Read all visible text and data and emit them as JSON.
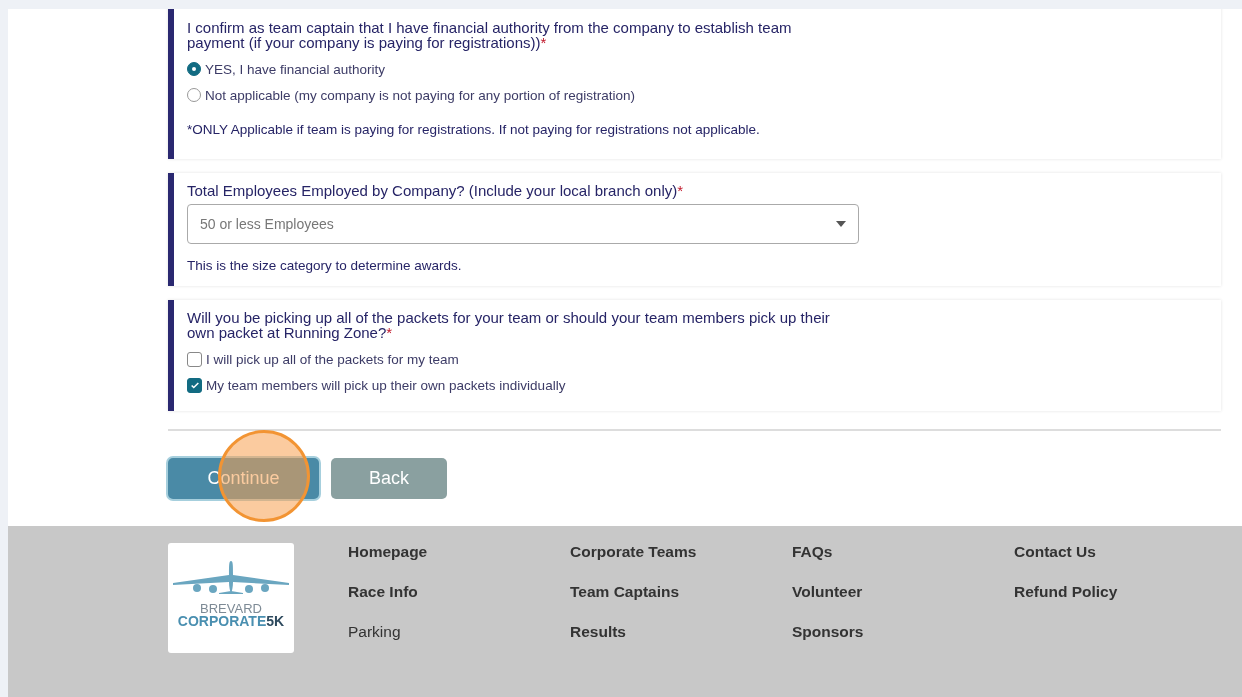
{
  "questions": [
    {
      "kind": "radio",
      "prompt": "I confirm as team captain that I have financial authority from the company to establish team payment (if your company is paying for registrations))",
      "required": true,
      "options": [
        {
          "label": "YES, I have financial authority",
          "selected": true
        },
        {
          "label": "Not applicable (my company is not paying for any portion of registration)",
          "selected": false
        }
      ],
      "note": "*ONLY Applicable if team is paying for registrations. If not paying for registrations not applicable."
    },
    {
      "kind": "select",
      "prompt": "Total Employees Employed by Company? (Include your local branch only)",
      "required": true,
      "value": "50 or less Employees",
      "note": "This is the size category to determine awards."
    },
    {
      "kind": "checkbox",
      "prompt": "Will you be picking up all of the packets for your team or should your team members pick up their own packet at Running Zone?",
      "required": true,
      "options": [
        {
          "label": "I will pick up all of the packets for my team",
          "checked": false
        },
        {
          "label": "My team members will pick up their own packets individually",
          "checked": true
        }
      ]
    }
  ],
  "required_mark": "*",
  "buttons": [
    {
      "label": "Continue",
      "kind": "primary"
    },
    {
      "label": "Back",
      "kind": "secondary"
    }
  ],
  "footer": {
    "logo": {
      "line_1": "BREVARD",
      "line_2": "CORPORATE",
      "line_2_suffix": "5K"
    },
    "columns": [
      [
        {
          "label": "Homepage",
          "bold": true
        },
        {
          "label": "Race Info",
          "bold": true
        },
        {
          "label": "Parking",
          "bold": false
        }
      ],
      [
        {
          "label": "Corporate Teams",
          "bold": true
        },
        {
          "label": "Team Captains",
          "bold": true
        },
        {
          "label": "Results",
          "bold": true
        }
      ],
      [
        {
          "label": "FAQs",
          "bold": true
        },
        {
          "label": "Volunteer",
          "bold": true
        },
        {
          "label": "Sponsors",
          "bold": true
        }
      ],
      [
        {
          "label": "Contact Us",
          "bold": true
        },
        {
          "label": "Refund Policy",
          "bold": true
        }
      ]
    ]
  }
}
